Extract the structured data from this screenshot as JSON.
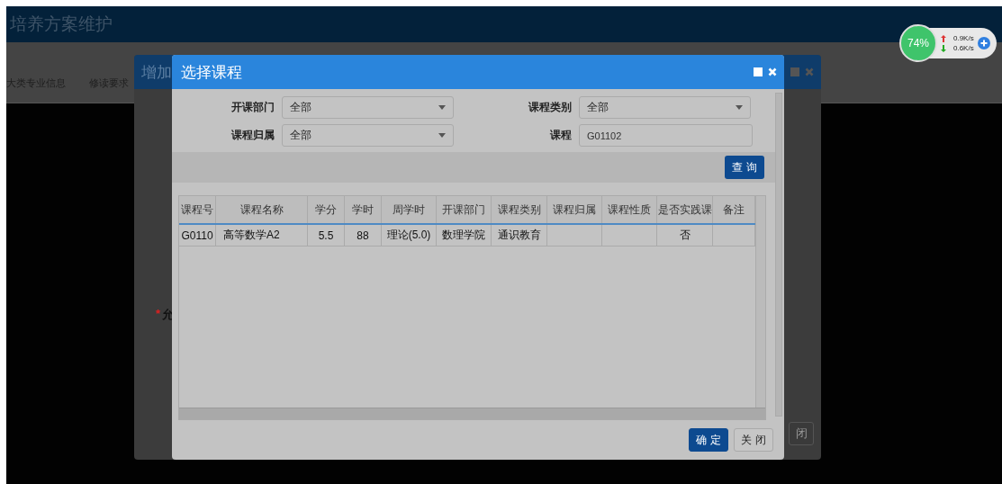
{
  "page": {
    "title": "培养方案维护",
    "tabs": [
      {
        "label": "大类专业信息",
        "selected": false
      },
      {
        "label": "修读要求",
        "selected": false
      }
    ],
    "required_mark": "*",
    "required_label": "允"
  },
  "background_dialog": {
    "title": "增加",
    "footer_button": "闭"
  },
  "net_widget": {
    "percent": "74%",
    "upload": "0.9K/s",
    "download": "0.6K/s"
  },
  "dialog": {
    "title": "选择课程",
    "filters": [
      {
        "kind": "select",
        "label": "开课部门",
        "value": "全部"
      },
      {
        "kind": "select",
        "label": "课程类别",
        "value": "全部"
      },
      {
        "kind": "select",
        "label": "课程归属",
        "value": "全部"
      },
      {
        "kind": "input",
        "label": "课程",
        "value": "G01102"
      }
    ],
    "search_button": "查 询",
    "table": {
      "columns": [
        "课程号",
        "课程名称",
        "学分",
        "学时",
        "周学时",
        "开课部门",
        "课程类别",
        "课程归属",
        "课程性质",
        "是否实践课",
        "备注"
      ],
      "rows": [
        {
          "cells": [
            "G0110",
            "高等数学A2",
            "5.5",
            "88",
            "理论(5.0)",
            "数理学院",
            "通识教育",
            "",
            "",
            "否",
            ""
          ]
        }
      ]
    },
    "buttons": [
      {
        "label": "确 定",
        "kind": "primary"
      },
      {
        "label": "关 闭",
        "kind": "default"
      }
    ]
  }
}
